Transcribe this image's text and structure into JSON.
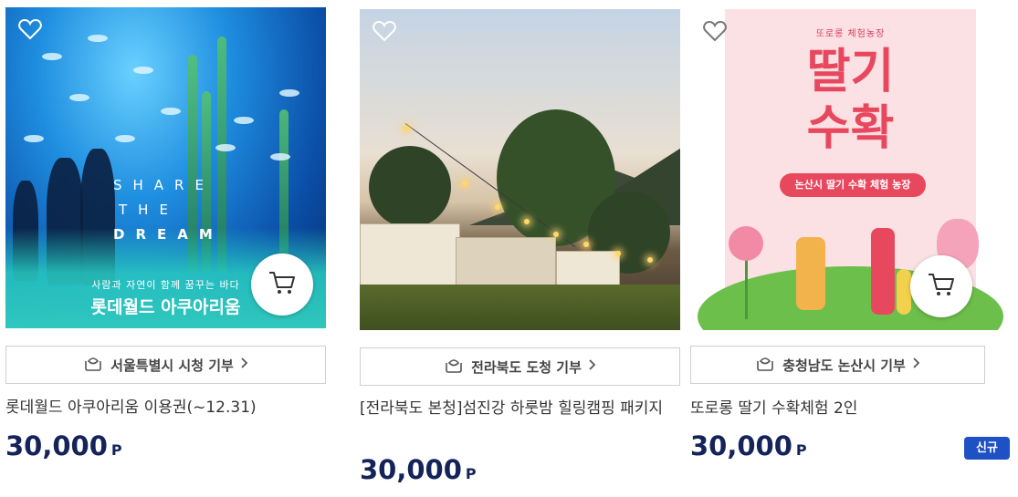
{
  "products": [
    {
      "image": {
        "share_lines": [
          "SHARE",
          "THE",
          "DREAM"
        ],
        "subtitle": "사람과 자연이 함께 꿈꾸는 바다",
        "headline": "롯데월드 아쿠아리움"
      },
      "donate_label": "서울특별시 시청 기부",
      "title": "롯데월드 아쿠아리움 이용권(~12.31)",
      "price": "30,000",
      "price_unit": "P"
    },
    {
      "donate_label": "전라북도 도청 기부",
      "title": "[전라북도 본청]섬진강 하룻밤 힐링캠핑 패키지",
      "price": "30,000",
      "price_unit": "P"
    },
    {
      "image": {
        "tag": "또로롱 체험농장",
        "big_line1": "딸기",
        "big_line2": "수확",
        "pill": "논산시 딸기 수확 체험 농장"
      },
      "donate_label": "충청남도 논산시 기부",
      "title": "또로롱 딸기 수확체험 2인",
      "price": "30,000",
      "price_unit": "P",
      "badge": "신규"
    }
  ],
  "icons": {
    "wishlist": "heart-outline-icon",
    "cart": "shopping-cart-icon",
    "donate": "donation-hands-icon",
    "chevron": "chevron-right-icon"
  },
  "colors": {
    "price": "#14245a",
    "badge": "#1e51c4",
    "border": "#cfcfcf"
  }
}
